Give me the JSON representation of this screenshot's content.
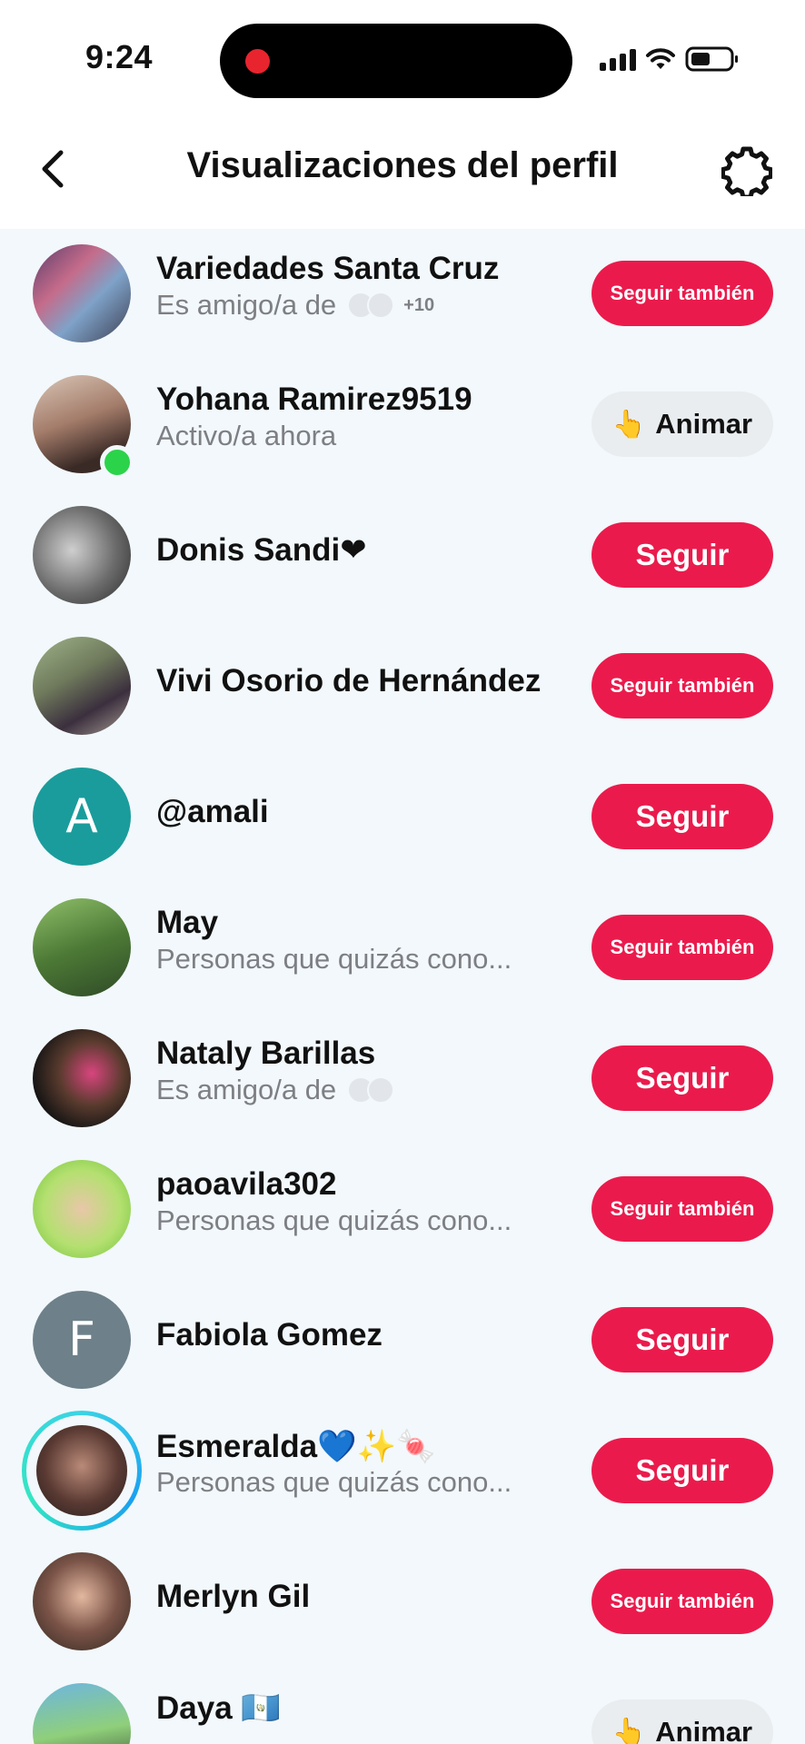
{
  "status": {
    "time": "9:24"
  },
  "header": {
    "title": "Visualizaciones del perfil"
  },
  "colors": {
    "accent": "#ea1b4c",
    "online": "#2bd34b",
    "list_bg": "#f2f8fb"
  },
  "rows": [
    {
      "name": "Variedades Santa Cruz",
      "subtitle": "Es amigo/a de",
      "extra": "+10",
      "button": "Seguir también"
    },
    {
      "name": "Yohana Ramirez9519",
      "subtitle": "Activo/a ahora",
      "button": "Animar",
      "button_icon": "👆"
    },
    {
      "name": "Donis Sandi❤",
      "button": "Seguir"
    },
    {
      "name": "Vivi Osorio de Hernández",
      "button": "Seguir también"
    },
    {
      "name": "@amali",
      "avatar_letter": "A",
      "button": "Seguir"
    },
    {
      "name": "May",
      "subtitle": "Personas que quizás cono...",
      "button": "Seguir también"
    },
    {
      "name": "Nataly Barillas",
      "subtitle": "Es amigo/a de",
      "button": "Seguir"
    },
    {
      "name": "paoavila302",
      "subtitle": "Personas que quizás cono...",
      "button": "Seguir también"
    },
    {
      "name": "Fabiola Gomez",
      "avatar_letter": "F",
      "button": "Seguir"
    },
    {
      "name": "Esmeralda💙✨🍬",
      "subtitle": "Personas que quizás cono...",
      "button": "Seguir"
    },
    {
      "name": "Merlyn Gil",
      "button": "Seguir también"
    },
    {
      "name": "Daya 🇬🇹",
      "button": "Animar",
      "button_icon": "👆"
    }
  ]
}
